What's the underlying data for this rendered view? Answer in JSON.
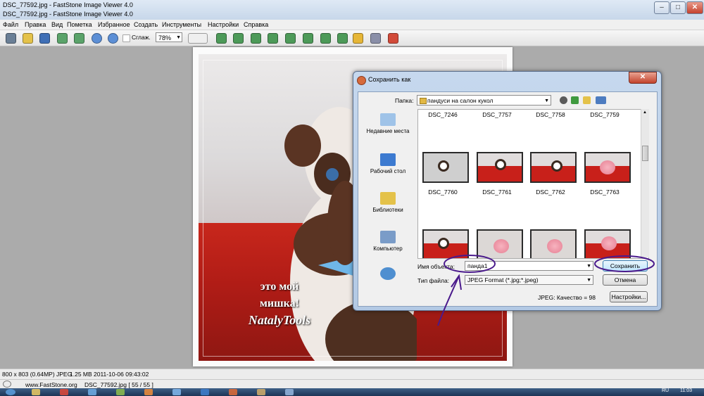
{
  "window": {
    "tab_title": "DSC_77592.jpg  -  FastStone Image Viewer 4.0",
    "title": "DSC_77592.jpg  -  FastStone Image Viewer 4.0"
  },
  "menu": [
    "Файл",
    "Правка",
    "Вид",
    "Пометка",
    "Избранное",
    "Создать",
    "Инструменты",
    "Настройки",
    "Справка"
  ],
  "toolbar": {
    "smooth_label": "Сглаж.",
    "zoom_value": "78%"
  },
  "image": {
    "caption_line1": "это мой",
    "caption_line2": "мишка!",
    "caption_line3": "NatalyTools"
  },
  "dialog": {
    "title": "Сохранить как",
    "folder_label": "Папка:",
    "folder_value": "пандуси на салон кукол",
    "places": [
      "Недавние места",
      "Рабочий стол",
      "Библиотеки",
      "Компьютер"
    ],
    "files_row1": [
      "DSC_7246",
      "DSC_7757",
      "DSC_7758",
      "DSC_7759"
    ],
    "files_row2": [
      "DSC_7760",
      "DSC_7761",
      "DSC_7762",
      "DSC_7763"
    ],
    "filename_label": "Имя объекта:",
    "filename_value": "панда1",
    "filetype_label": "Тип файла:",
    "filetype_value": "JPEG Format (*.jpg;*.jpeg)",
    "save_button": "Сохранить",
    "cancel_button": "Отмена",
    "quality_text": "JPEG: Качество = 98",
    "settings_button": "Настройки..."
  },
  "status": {
    "dimensions": "800 x 803 (0.64MP) JPEG",
    "size": "1.25 MB",
    "date": "2011-10-06 09:43:02",
    "site": "www.FastStone.org",
    "file_index": "DSC_77592.jpg [ 55 / 55 ]"
  },
  "taskbar": {
    "lang": "RU",
    "clock": "11:03"
  },
  "colors": {
    "annotation": "#4a1a8c",
    "dialog_frame": "#b3c9e4",
    "photo_red": "#c8271c"
  }
}
